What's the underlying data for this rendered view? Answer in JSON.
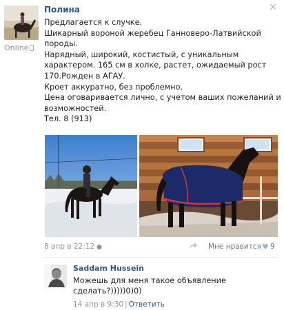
{
  "post": {
    "author": "Полина",
    "status": "Online",
    "text_lines": [
      "Предлагается к случке.",
      "Шикарный вороной жеребец Ганноверо-Латвийской",
      "породы.",
      "Нарядный, широкий, костистый, с уникальным",
      "характером. 165 см в холке, растет, ожидаемый рост",
      "170.Рожден в АГАУ.",
      "Кроет аккуратно, без проблемно.",
      "Цена оговаривается лично, с учетом ваших пожеланий и",
      "возможностей.",
      "Тел. 8 (913)"
    ],
    "date": "8 апр в 22:12",
    "like_label": "Мне нравится",
    "like_count": "9"
  },
  "comment": {
    "author": "Saddam Hussein",
    "text_lines": [
      "Можешь для меня такое объявление",
      "сделать?)))))0)0)"
    ],
    "date": "14 апр в 9:30",
    "separator": "|",
    "reply_label": "Ответить"
  },
  "icons": {
    "close": "close-icon",
    "online_device": "mobile-phone-icon",
    "post_device": "apple-icon",
    "share": "share-icon",
    "like": "heart-icon"
  },
  "colors": {
    "link": "#2a5885",
    "meta": "#939393",
    "divider": "#e7e8ec"
  }
}
